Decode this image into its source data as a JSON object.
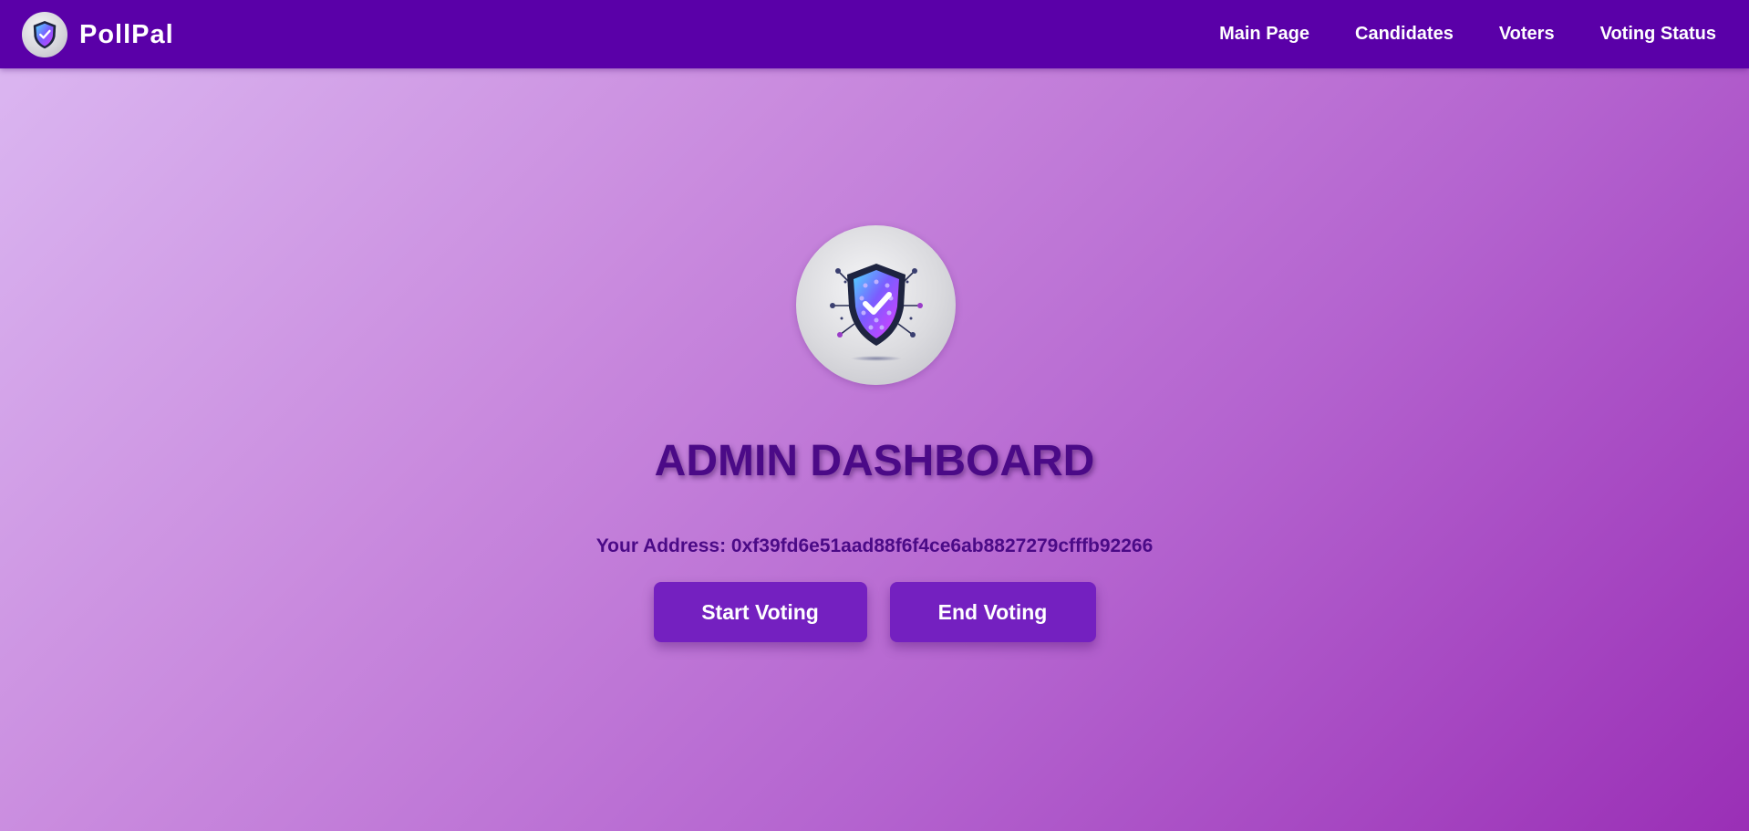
{
  "app": {
    "brand_name": "PollPal",
    "logo_icon": "shield-check-icon"
  },
  "nav": {
    "items": [
      {
        "label": "Main Page"
      },
      {
        "label": "Candidates"
      },
      {
        "label": "Voters"
      },
      {
        "label": "Voting Status"
      }
    ]
  },
  "main": {
    "title": "ADMIN DASHBOARD",
    "address_text": "Your Address: 0xf39fd6e51aad88f6f4ce6ab8827279cfffb92266",
    "start_button": "Start Voting",
    "end_button": "End Voting"
  },
  "colors": {
    "navbar": "#5a00a8",
    "button": "#7420c0",
    "title": "#4b0a87",
    "gradient_start": "#dcb9f2",
    "gradient_end": "#9a2fb6"
  }
}
